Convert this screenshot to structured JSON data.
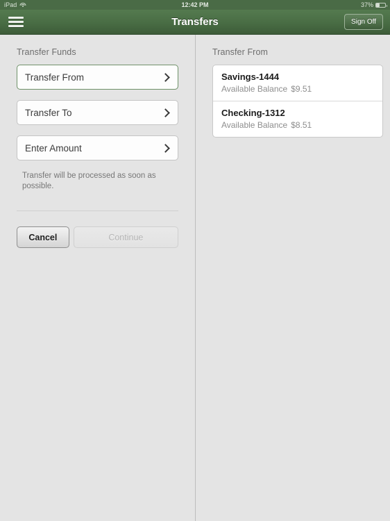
{
  "status_bar": {
    "carrier": "iPad",
    "wifi_icon": "wifi-icon",
    "time": "12:42 PM",
    "battery_percent": "37%",
    "battery_icon": "battery-icon",
    "battery_level": 37
  },
  "nav_bar": {
    "menu_icon": "hamburger-menu-icon",
    "title": "Transfers",
    "sign_off_label": "Sign Off"
  },
  "left_pane": {
    "section_label": "Transfer Funds",
    "fields": [
      {
        "label": "Transfer From",
        "active": true,
        "chevron": "chevron-right-icon"
      },
      {
        "label": "Transfer To",
        "active": false,
        "chevron": "chevron-right-icon"
      },
      {
        "label": "Enter Amount",
        "active": false,
        "chevron": "chevron-right-icon"
      }
    ],
    "helper_text": "Transfer will be processed as soon as possible.",
    "cancel_label": "Cancel",
    "continue_label": "Continue",
    "continue_disabled": true
  },
  "right_pane": {
    "section_label": "Transfer From",
    "accounts": [
      {
        "name": "Savings-1444",
        "balance_label": "Available Balance",
        "balance": "$9.51"
      },
      {
        "name": "Checking-1312",
        "balance_label": "Available Balance",
        "balance": "$8.51"
      }
    ]
  },
  "colors": {
    "nav_green_top": "#547a4f",
    "nav_green_bottom": "#3d5c39",
    "status_green": "#4a6b46",
    "page_background": "#e4e4e4",
    "active_field_border": "#6f9169"
  }
}
